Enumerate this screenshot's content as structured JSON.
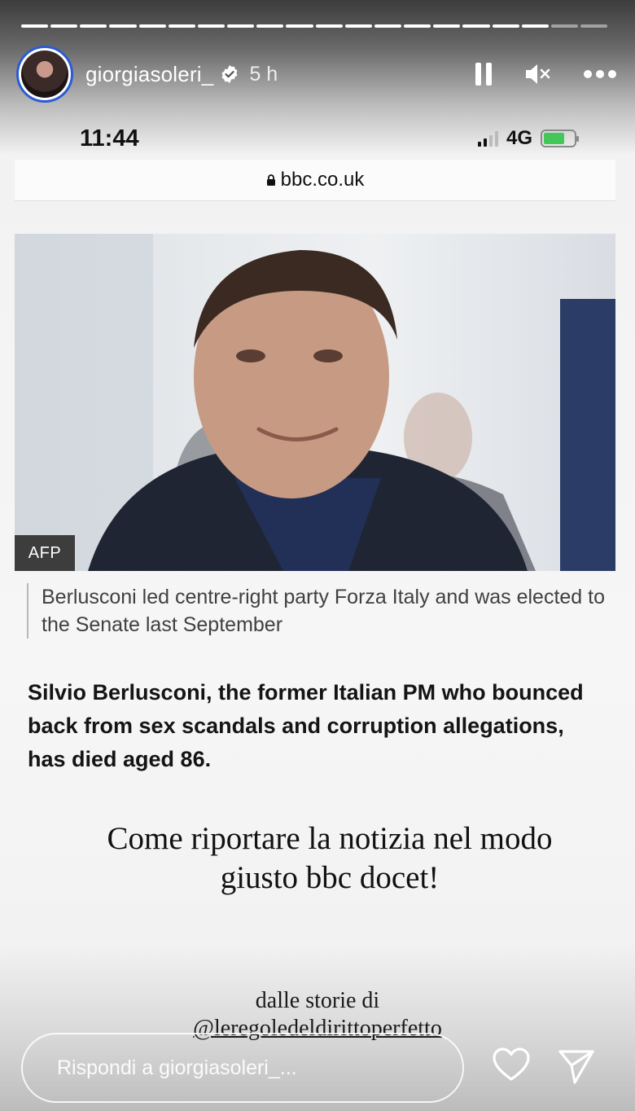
{
  "story": {
    "progress_segments": 20,
    "progress_viewed": 18,
    "username": "giorgiasoleri_",
    "time_ago": "5 h",
    "controls": {
      "pause_icon": "pause-icon",
      "mute_icon": "speaker-muted-icon",
      "more_icon": "more-dots-icon"
    }
  },
  "screenshot": {
    "status_bar": {
      "time": "11:44",
      "network": "4G",
      "signal_bars_active": 2,
      "battery_charging": true
    },
    "url": "bbc.co.uk",
    "photo_credit": "AFP",
    "caption": "Berlusconi led centre-right party Forza Italy and was elected to the Senate last September",
    "lead": "Silvio Berlusconi, the former Italian PM who bounced back from sex scandals and corruption allegations, has died aged 86."
  },
  "overlay": {
    "text_line1": "Come riportare la notizia nel modo",
    "text_line2": "giusto bbc docet!",
    "credit_prefix": "dalle storie di",
    "credit_handle": "@leregoledeldirittoperfetto"
  },
  "reply": {
    "placeholder": "Rispondi a giorgiasoleri_..."
  },
  "colors": {
    "avatar_ring": "#2a5bd7",
    "battery_fill": "#44c759"
  }
}
